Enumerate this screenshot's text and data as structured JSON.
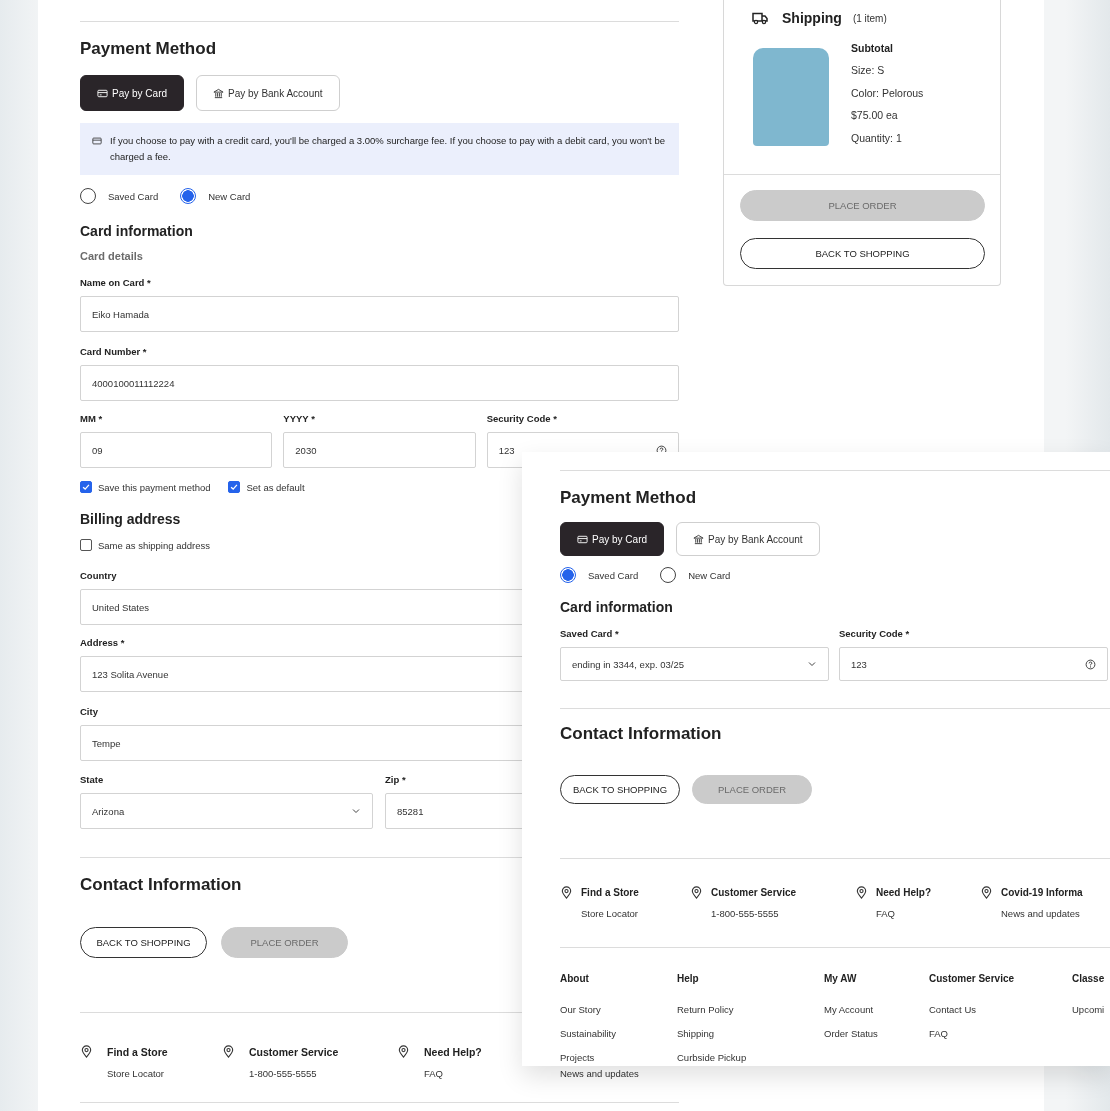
{
  "checkout": {
    "payment_method": {
      "title": "Payment Method",
      "tabs": [
        {
          "label": "Pay by Card",
          "kind": "card",
          "selected": true
        },
        {
          "label": "Pay by Bank Account",
          "kind": "bank",
          "selected": false
        }
      ],
      "notice": "If you choose to pay with a credit card, you'll be charged a 3.00% surcharge fee. If you choose to pay with a debit card, you won't be charged a fee.",
      "card_options": [
        {
          "label": "Saved Card",
          "selected": false
        },
        {
          "label": "New Card",
          "selected": true
        }
      ]
    },
    "card_information": {
      "title": "Card information",
      "subtitle": "Card details",
      "name": {
        "label": "Name on Card *",
        "value": "Eiko Hamada"
      },
      "number": {
        "label": "Card Number *",
        "value": "4000100011112224"
      },
      "month": {
        "label": "MM *",
        "value": "09"
      },
      "year": {
        "label": "YYYY *",
        "value": "2030"
      },
      "security": {
        "label": "Security Code *",
        "value": "123"
      },
      "options": [
        {
          "label": "Save this payment method",
          "checked": true
        },
        {
          "label": "Set as default",
          "checked": true
        }
      ]
    },
    "billing_address": {
      "title": "Billing address",
      "same_as_shipping": {
        "label": "Same as shipping address",
        "checked": false
      },
      "country": {
        "label": "Country",
        "value": "United States"
      },
      "address": {
        "label": "Address *",
        "value": "123 Solita Avenue"
      },
      "city": {
        "label": "City",
        "value": "Tempe"
      },
      "state": {
        "label": "State",
        "value": "Arizona"
      },
      "zip": {
        "label": "Zip *",
        "value": "85281"
      }
    },
    "contact_information": {
      "title": "Contact Information",
      "buttons": [
        {
          "label": "BACK TO SHOPPING",
          "disabled": false
        },
        {
          "label": "PLACE ORDER",
          "disabled": true
        }
      ]
    },
    "footer": [
      {
        "title": "Find a Store",
        "subtitle": "Store Locator"
      },
      {
        "title": "Customer Service",
        "subtitle": "1-800-555-5555"
      },
      {
        "title": "Need Help?",
        "subtitle": "FAQ"
      },
      {
        "subtitle": "News and updates"
      }
    ],
    "order_summary": {
      "title": "Shipping",
      "count": "(1 item)",
      "heading": "Subtotal",
      "details": [
        "Size: S",
        "Color: Pelorous",
        "$75.00 ea",
        "Quantity: 1"
      ],
      "buttons": [
        {
          "label": "PLACE ORDER",
          "disabled": true
        },
        {
          "label": "BACK TO SHOPPING",
          "disabled": false
        }
      ]
    }
  },
  "overlay": {
    "payment_method": {
      "title": "Payment Method",
      "tabs": [
        {
          "label": "Pay by Card",
          "kind": "card",
          "selected": true
        },
        {
          "label": "Pay by Bank Account",
          "kind": "bank",
          "selected": false
        }
      ],
      "card_options": [
        {
          "label": "Saved Card",
          "selected": true
        },
        {
          "label": "New Card",
          "selected": false
        }
      ]
    },
    "card_information": {
      "title": "Card information",
      "saved_card": {
        "label": "Saved Card *",
        "value": "ending in 3344, exp. 03/25"
      },
      "security": {
        "label": "Security Code *",
        "value": "123"
      }
    },
    "contact_information": {
      "title": "Contact Information",
      "buttons": [
        {
          "label": "BACK TO SHOPPING",
          "disabled": false
        },
        {
          "label": "PLACE ORDER",
          "disabled": true
        }
      ]
    },
    "footer": [
      {
        "title": "Find a Store",
        "subtitle": "Store Locator"
      },
      {
        "title": "Customer Service",
        "subtitle": "1-800-555-5555"
      },
      {
        "title": "Need Help?",
        "subtitle": "FAQ"
      },
      {
        "title": "Covid-19 Informa",
        "subtitle": "News and updates"
      }
    ],
    "link_columns": [
      {
        "title": "About",
        "links": [
          "Our Story",
          "Sustainability",
          "Projects"
        ]
      },
      {
        "title": "Help",
        "links": [
          "Return Policy",
          "Shipping",
          "Curbside Pickup"
        ]
      },
      {
        "title": "My AW",
        "links": [
          "My Account",
          "Order Status"
        ]
      },
      {
        "title": "Customer Service",
        "links": [
          "Contact Us",
          "FAQ"
        ]
      },
      {
        "title": "Classe",
        "links": [
          "Upcomi"
        ]
      }
    ]
  }
}
